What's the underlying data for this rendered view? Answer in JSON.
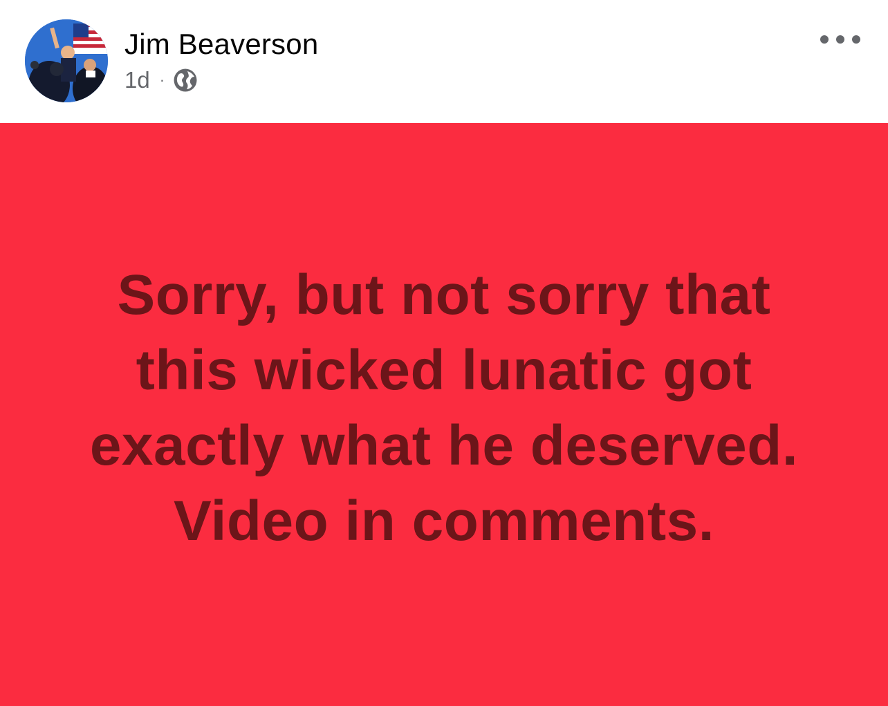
{
  "post": {
    "author": "Jim Beaverson",
    "timestamp": "1d",
    "separator": "·",
    "audience_icon": "globe-icon",
    "more_icon": "more-options-icon",
    "card_text": "Sorry, but not sorry that this wicked lunatic got exactly what he deserved. Video in comments.",
    "card_background": "#fb2c40",
    "card_text_color": "#6c1519"
  }
}
